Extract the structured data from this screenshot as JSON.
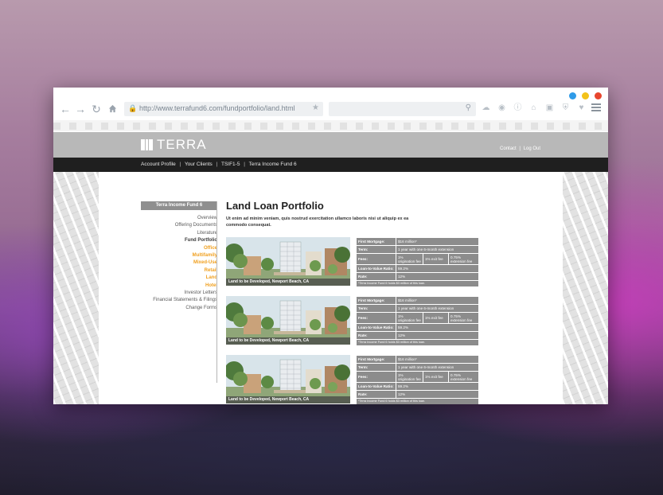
{
  "window": {
    "traffic_lights": [
      {
        "name": "blue",
        "color": "#2f9be8"
      },
      {
        "name": "yellow",
        "color": "#f3c21a"
      },
      {
        "name": "red",
        "color": "#e8462e"
      }
    ]
  },
  "browser": {
    "url": "http://www.terrafund6.com/fundportfolio/land.html",
    "search_placeholder": "",
    "toolbar_icons": [
      "cloud-icon",
      "camera-icon",
      "info-icon",
      "home-icon",
      "briefcase-icon",
      "shield-icon",
      "heart-icon"
    ]
  },
  "site": {
    "logo_text": "TERRA",
    "header_links": {
      "contact": "Contact",
      "separator": "|",
      "logout": "Log Out"
    },
    "nav": {
      "separator": "|",
      "items": [
        "Account Profile",
        "Your Clients",
        "TSIF1-5",
        "Terra Income Fund 6"
      ]
    },
    "sidebar": {
      "heading": "Terra Income Fund 6",
      "items": [
        {
          "label": "Overview",
          "style": "normal"
        },
        {
          "label": "Offering Documents",
          "style": "normal"
        },
        {
          "label": "Literature",
          "style": "normal"
        },
        {
          "label": "Fund Portfolio",
          "style": "bold"
        },
        {
          "label": "Office",
          "style": "sub"
        },
        {
          "label": "Multifamily",
          "style": "sub"
        },
        {
          "label": "Mixed-Use",
          "style": "sub"
        },
        {
          "label": "Retail",
          "style": "sub"
        },
        {
          "label": "Land",
          "style": "sub"
        },
        {
          "label": "Hotel",
          "style": "sub"
        },
        {
          "label": "Investor Letters",
          "style": "normal"
        },
        {
          "label": "Financial Statements & Filings",
          "style": "normal"
        },
        {
          "label": "Change Forms",
          "style": "normal"
        }
      ]
    },
    "main": {
      "title": "Land Loan Portfolio",
      "intro": "Ut enim ad minim veniam, quis nostrud exercitation ullamco laboris nisi ut aliquip ex ea commodo consequat.",
      "loans": [
        {
          "caption": "Land to be Developed, Newport Beach, CA",
          "first_mortgage_label": "First Mortgage:",
          "first_mortgage_value": "$16 million*",
          "term_label": "Term:",
          "term_value": "1 year with one 6-month extension",
          "fees_label": "Fees:",
          "fee_origination": "1% origination fee",
          "fee_exit": "1% exit fee",
          "fee_extension": "0.75% extension fee",
          "ltv_label": "Loan-to-Value Ratio:",
          "ltv_value": "59.2%",
          "rate_label": "Rate:",
          "rate_value": "12%",
          "note": "*Terra Income Fund 6 holds $3 million of this loan."
        },
        {
          "caption": "Land to be Developed, Newport Beach, CA",
          "first_mortgage_label": "First Mortgage:",
          "first_mortgage_value": "$16 million*",
          "term_label": "Term:",
          "term_value": "1 year with one 6-month extension",
          "fees_label": "Fees:",
          "fee_origination": "1% origination fee",
          "fee_exit": "1% exit fee",
          "fee_extension": "0.75% extension fee",
          "ltv_label": "Loan-to-Value Ratio:",
          "ltv_value": "59.2%",
          "rate_label": "Rate:",
          "rate_value": "12%",
          "note": "*Terra Income Fund 6 holds $3 million of this loan."
        },
        {
          "caption": "Land to be Developed, Newport Beach, CA",
          "first_mortgage_label": "First Mortgage:",
          "first_mortgage_value": "$16 million*",
          "term_label": "Term:",
          "term_value": "1 year with one 6-month extension",
          "fees_label": "Fees:",
          "fee_origination": "1% origination fee",
          "fee_exit": "1% exit fee",
          "fee_extension": "0.75% extension fee",
          "ltv_label": "Loan-to-Value Ratio:",
          "ltv_value": "59.2%",
          "rate_label": "Rate:",
          "rate_value": "12%",
          "note": "*Terra Income Fund 6 holds $3 million of this loan."
        }
      ]
    }
  }
}
